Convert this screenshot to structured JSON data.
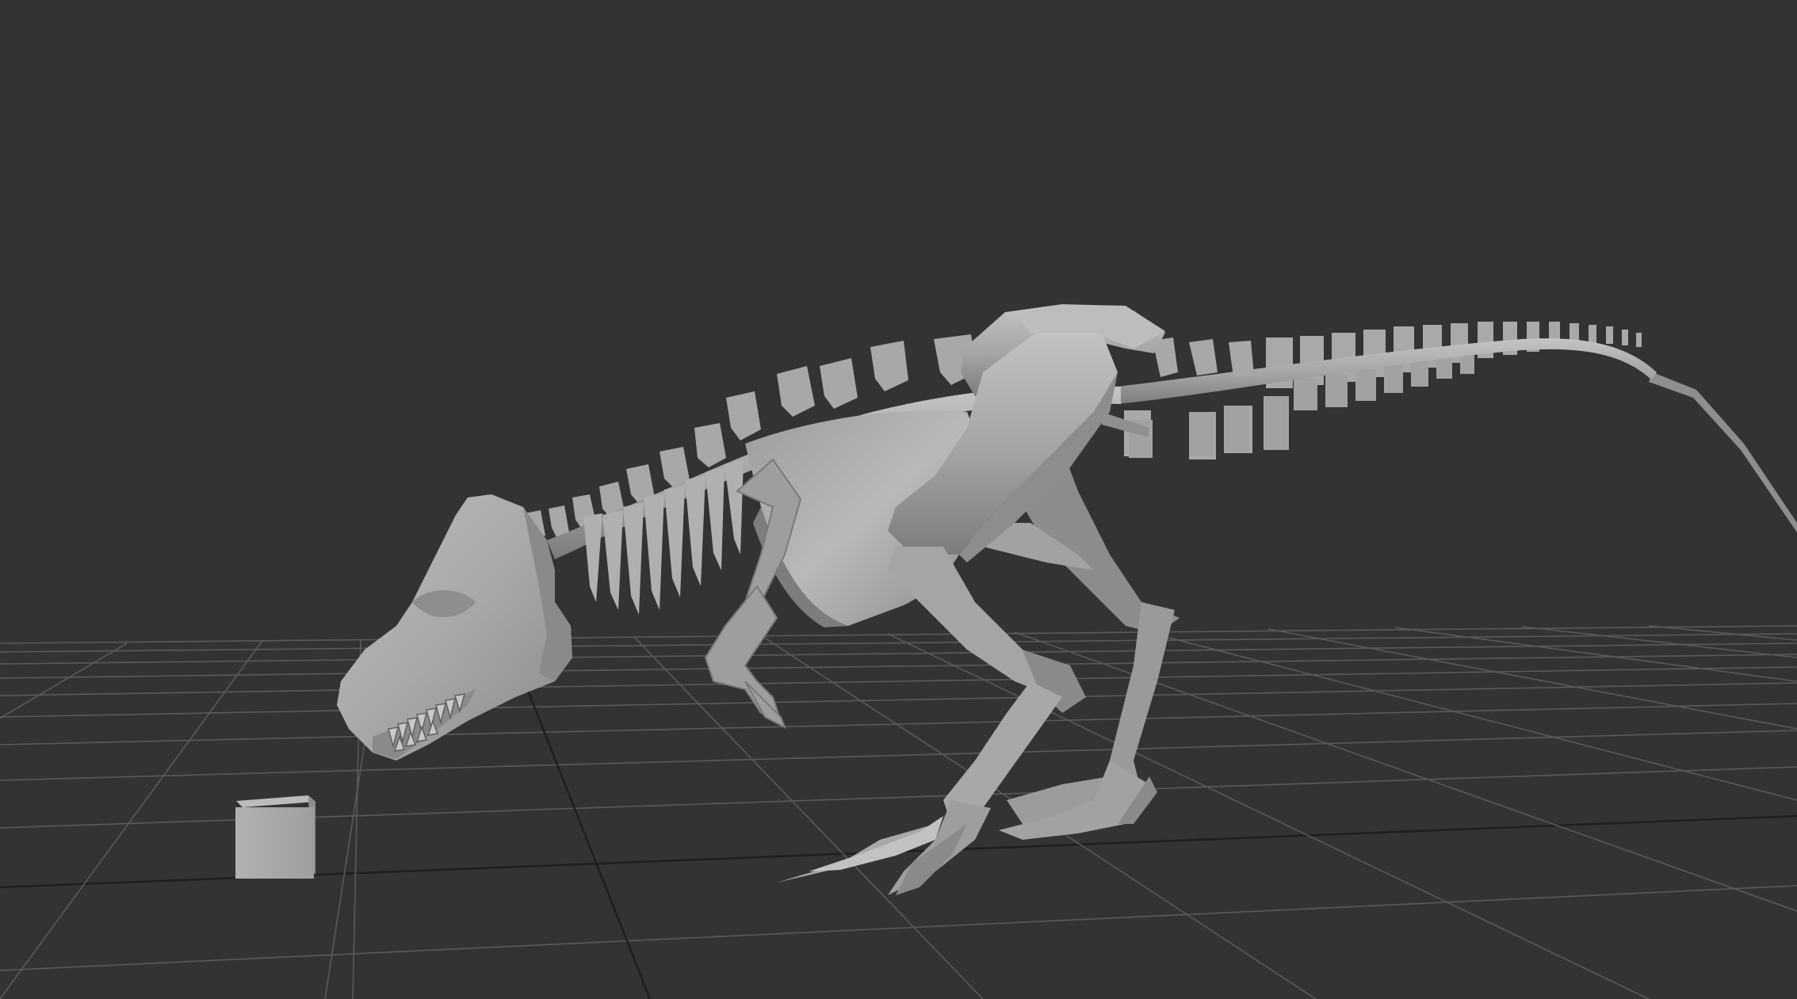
{
  "viewport": {
    "background_color": "#333333",
    "grid_color": "#5a5a5a",
    "grid_axis_color": "#1e1e1e",
    "model_color": "#a6a6a6",
    "model_light_color": "#c2c2c2",
    "model_dark_color": "#7a7a7a",
    "objects": [
      {
        "name": "trex-skeleton-model",
        "type": "polygon-mesh"
      },
      {
        "name": "reference-cube",
        "type": "polygon-cube"
      }
    ]
  }
}
